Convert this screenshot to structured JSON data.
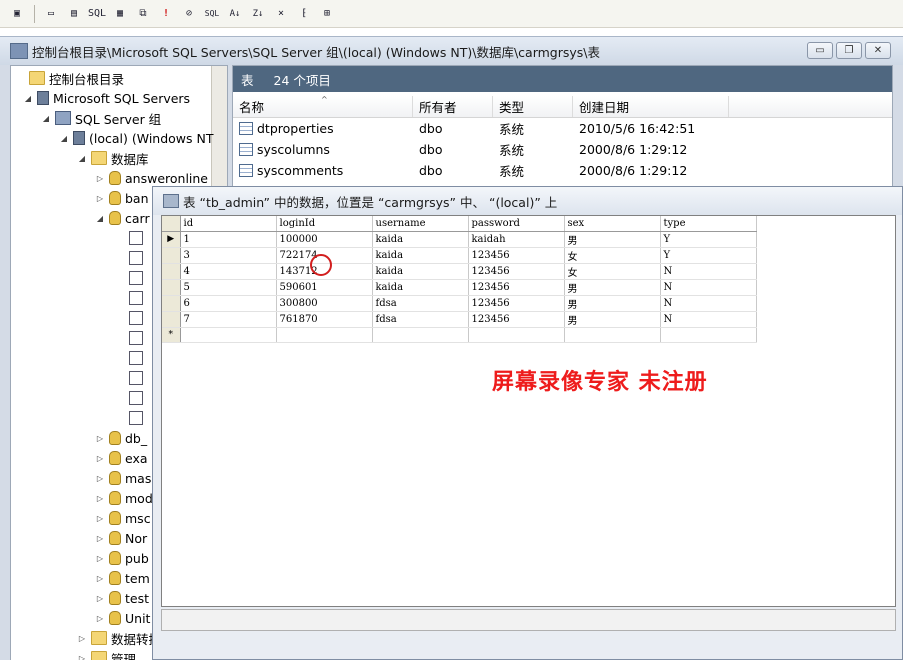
{
  "toolbar": {
    "buttons": [
      "properties-icon",
      "new-view-icon",
      "table-icon",
      "sql-icon",
      "grid-icon",
      "query-icon",
      "run-icon",
      "verify-icon",
      "check-sql-icon",
      "sort-asc-icon",
      "sort-desc-icon",
      "filter-icon",
      "group-by-icon",
      "add-table-icon"
    ],
    "labels": {
      "sql": "SQL",
      "run": "!",
      "check": "SQL",
      "sortAsc": "A↓",
      "sortDesc": "Z↓"
    }
  },
  "mmc": {
    "title": "控制台根目录\\Microsoft SQL Servers\\SQL Server 组\\(local) (Windows NT)\\数据库\\carmgrsys\\表",
    "win_min": "▭",
    "win_restore": "❐",
    "win_close": "✕"
  },
  "tree": {
    "items": [
      {
        "label": "控制台根目录",
        "twisty": "",
        "icon": "folder"
      },
      {
        "label": "Microsoft SQL Servers",
        "twisty": "◢",
        "icon": "server"
      },
      {
        "label": "SQL Server 组",
        "twisty": "◢",
        "icon": "group"
      },
      {
        "label": "(local) (Windows NT",
        "twisty": "◢",
        "icon": "server"
      },
      {
        "label": "数据库",
        "twisty": "◢",
        "icon": "folder"
      },
      {
        "label": "answeronline",
        "twisty": "▷",
        "icon": "db"
      },
      {
        "label": "ban",
        "twisty": "▷",
        "icon": "db"
      },
      {
        "label": "carr",
        "twisty": "◢",
        "icon": "db"
      },
      {
        "label": "db_",
        "twisty": "▷",
        "icon": "db"
      },
      {
        "label": "exa",
        "twisty": "▷",
        "icon": "db"
      },
      {
        "label": "mas",
        "twisty": "▷",
        "icon": "db"
      },
      {
        "label": "mod",
        "twisty": "▷",
        "icon": "db"
      },
      {
        "label": "msc",
        "twisty": "▷",
        "icon": "db"
      },
      {
        "label": "Nor",
        "twisty": "▷",
        "icon": "db"
      },
      {
        "label": "pub",
        "twisty": "▷",
        "icon": "db"
      },
      {
        "label": "tem",
        "twisty": "▷",
        "icon": "db"
      },
      {
        "label": "test",
        "twisty": "▷",
        "icon": "db"
      },
      {
        "label": "Unit",
        "twisty": "▷",
        "icon": "db"
      },
      {
        "label": "数据转换服务",
        "twisty": "▷",
        "icon": "folder"
      },
      {
        "label": "管理",
        "twisty": "▷",
        "icon": "folder"
      }
    ],
    "sub_icons": [
      "diagram-icon",
      "tables-icon",
      "views-icon",
      "stored-procs-icon",
      "users-icon",
      "roles-icon",
      "rules-icon",
      "defaults-icon",
      "udt-icon",
      "udf-icon"
    ]
  },
  "list": {
    "header_title": "表",
    "header_count": "24 个项目",
    "columns": [
      "名称",
      "所有者",
      "类型",
      "创建日期"
    ],
    "sort_caret": "^",
    "rows": [
      {
        "name": "dtproperties",
        "owner": "dbo",
        "type": "系统",
        "created": "2010/5/6 16:42:51"
      },
      {
        "name": "syscolumns",
        "owner": "dbo",
        "type": "系统",
        "created": "2000/8/6 1:29:12"
      },
      {
        "name": "syscomments",
        "owner": "dbo",
        "type": "系统",
        "created": "2000/8/6 1:29:12"
      }
    ]
  },
  "datawin": {
    "title": "表 “tb_admin” 中的数据，位置是 “carmgrsys” 中、 “(local)” 上",
    "columns": [
      "id",
      "loginId",
      "username",
      "password",
      "sex",
      "type"
    ],
    "rows": [
      {
        "marker": "▶",
        "id": "1",
        "loginId": "100000",
        "username": "kaida",
        "password": "kaidah",
        "sex": "男",
        "type": "Y"
      },
      {
        "marker": "",
        "id": "3",
        "loginId": "722174",
        "username": "kaida",
        "password": "123456",
        "sex": "女",
        "type": "Y"
      },
      {
        "marker": "",
        "id": "4",
        "loginId": "143712",
        "username": "kaida",
        "password": "123456",
        "sex": "女",
        "type": "N"
      },
      {
        "marker": "",
        "id": "5",
        "loginId": "590601",
        "username": "kaida",
        "password": "123456",
        "sex": "男",
        "type": "N"
      },
      {
        "marker": "",
        "id": "6",
        "loginId": "300800",
        "username": "fdsa",
        "password": "123456",
        "sex": "男",
        "type": "N"
      },
      {
        "marker": "",
        "id": "7",
        "loginId": "761870",
        "username": "fdsa",
        "password": "123456",
        "sex": "男",
        "type": "N"
      }
    ],
    "new_row_marker": "*"
  },
  "watermark": "屏幕录像专家  未注册"
}
